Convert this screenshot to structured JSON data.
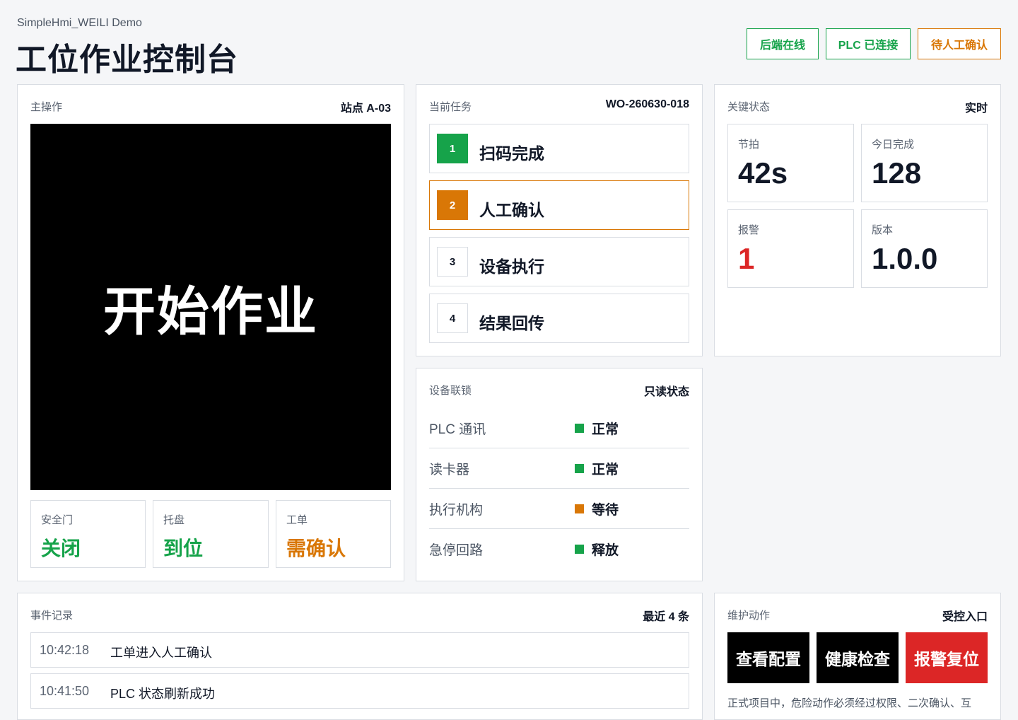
{
  "header": {
    "app_name": "SimpleHmi_WEILI Demo",
    "title": "工位作业控制台",
    "badges": [
      {
        "label": "后端在线",
        "color": "#16a34a"
      },
      {
        "label": "PLC 已连接",
        "color": "#16a34a"
      },
      {
        "label": "待人工确认",
        "color": "#d97706"
      }
    ]
  },
  "main_op": {
    "label": "主操作",
    "station": "站点 A-03",
    "start_button": "开始作业",
    "status": [
      {
        "label": "安全门",
        "value": "关闭",
        "color": "#16a34a"
      },
      {
        "label": "托盘",
        "value": "到位",
        "color": "#16a34a"
      },
      {
        "label": "工单",
        "value": "需确认",
        "color": "#d97706"
      }
    ]
  },
  "task": {
    "label": "当前任务",
    "order_id": "WO-260630-018",
    "steps": [
      {
        "num": "1",
        "label": "扫码完成",
        "state": "done"
      },
      {
        "num": "2",
        "label": "人工确认",
        "state": "active"
      },
      {
        "num": "3",
        "label": "设备执行",
        "state": "pending"
      },
      {
        "num": "4",
        "label": "结果回传",
        "state": "pending"
      }
    ]
  },
  "interlock": {
    "label": "设备联锁",
    "tag": "只读状态",
    "rows": [
      {
        "name": "PLC 通讯",
        "status": "正常",
        "color": "#16a34a"
      },
      {
        "name": "读卡器",
        "status": "正常",
        "color": "#16a34a"
      },
      {
        "name": "执行机构",
        "status": "等待",
        "color": "#d97706"
      },
      {
        "name": "急停回路",
        "status": "释放",
        "color": "#16a34a"
      }
    ]
  },
  "key_status": {
    "label": "关键状态",
    "tag": "实时",
    "metrics": [
      {
        "label": "节拍",
        "value": "42s",
        "color": "#111827"
      },
      {
        "label": "今日完成",
        "value": "128",
        "color": "#111827"
      },
      {
        "label": "报警",
        "value": "1",
        "color": "#dc2626"
      },
      {
        "label": "版本",
        "value": "1.0.0",
        "color": "#111827"
      }
    ]
  },
  "events": {
    "label": "事件记录",
    "tag": "最近 4 条",
    "items": [
      {
        "time": "10:42:18",
        "message": "工单进入人工确认"
      },
      {
        "time": "10:41:50",
        "message": "PLC 状态刷新成功"
      }
    ]
  },
  "maintenance": {
    "label": "维护动作",
    "tag": "受控入口",
    "buttons": [
      {
        "label": "查看配置",
        "color": "#000000"
      },
      {
        "label": "健康检查",
        "color": "#000000"
      },
      {
        "label": "报警复位",
        "color": "#dc2626"
      }
    ],
    "note": "正式项目中，危险动作必须经过权限、二次确认、互"
  },
  "colors": {
    "green": "#16a34a",
    "orange": "#d97706",
    "red": "#dc2626",
    "border": "#d9dde3"
  }
}
